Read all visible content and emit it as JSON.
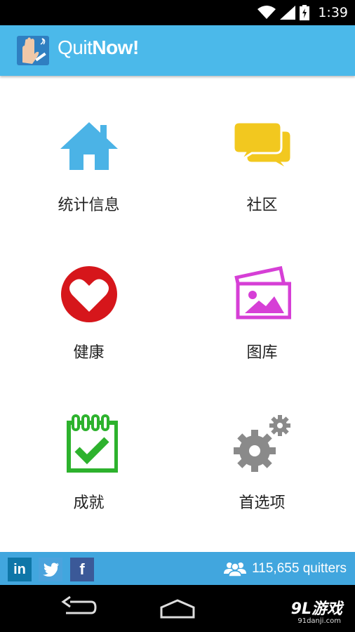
{
  "status_bar": {
    "time": "1:39"
  },
  "app_bar": {
    "title_light": "Quit",
    "title_bold": "Now!"
  },
  "menu": [
    {
      "label": "统计信息",
      "icon": "home-icon",
      "color": "#4bb3e6"
    },
    {
      "label": "社区",
      "icon": "chat-bubbles-icon",
      "color": "#f2c81f"
    },
    {
      "label": "健康",
      "icon": "heart-icon",
      "color": "#d6161b"
    },
    {
      "label": "图库",
      "icon": "gallery-icon",
      "color": "#d63fd6"
    },
    {
      "label": "成就",
      "icon": "calendar-check-icon",
      "color": "#2db22d"
    },
    {
      "label": "首选项",
      "icon": "gears-icon",
      "color": "#8a8a8a"
    }
  ],
  "footer": {
    "social": [
      "in",
      "f"
    ],
    "quitters": "115,655 quitters"
  },
  "watermark": {
    "brand": "9L游戏",
    "site": "91danji.com"
  },
  "colors": {
    "app_bar": "#4bb9ea",
    "footer": "#41a6de",
    "linkedin": "#0e76a8",
    "twitter": "#4ba3dd",
    "facebook": "#3b5998"
  }
}
